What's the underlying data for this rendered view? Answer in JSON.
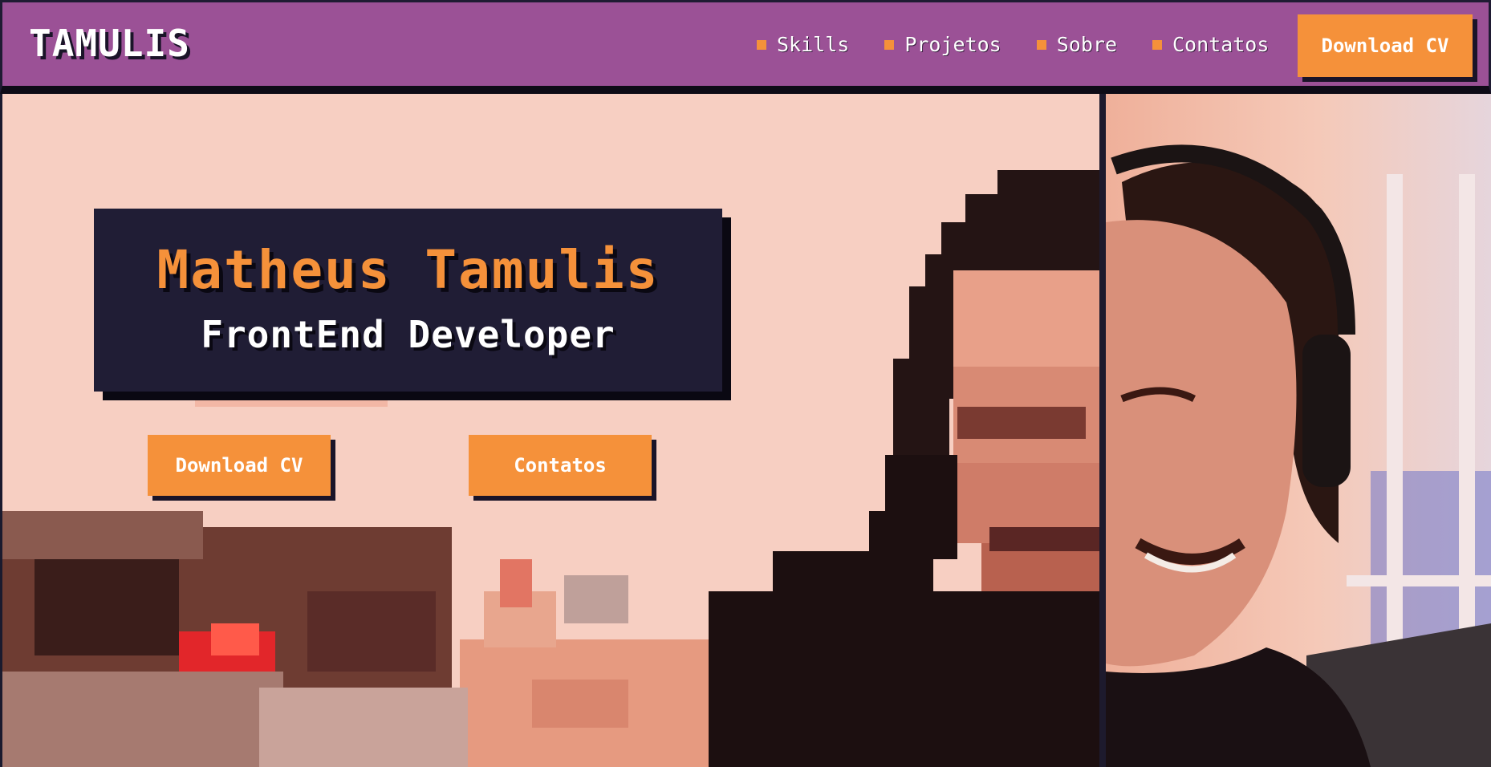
{
  "header": {
    "logo": "TAMULIS",
    "nav": [
      {
        "label": "Skills"
      },
      {
        "label": "Projetos"
      },
      {
        "label": "Sobre"
      },
      {
        "label": "Contatos"
      }
    ],
    "cta_label": "Download CV"
  },
  "hero": {
    "name": "Matheus Tamulis",
    "role": "FrontEnd Developer",
    "buttons": {
      "download_cv": "Download CV",
      "contatos": "Contatos"
    }
  },
  "colors": {
    "header_bg": "#9b5196",
    "accent": "#f5913a",
    "card_bg": "#201d35"
  }
}
